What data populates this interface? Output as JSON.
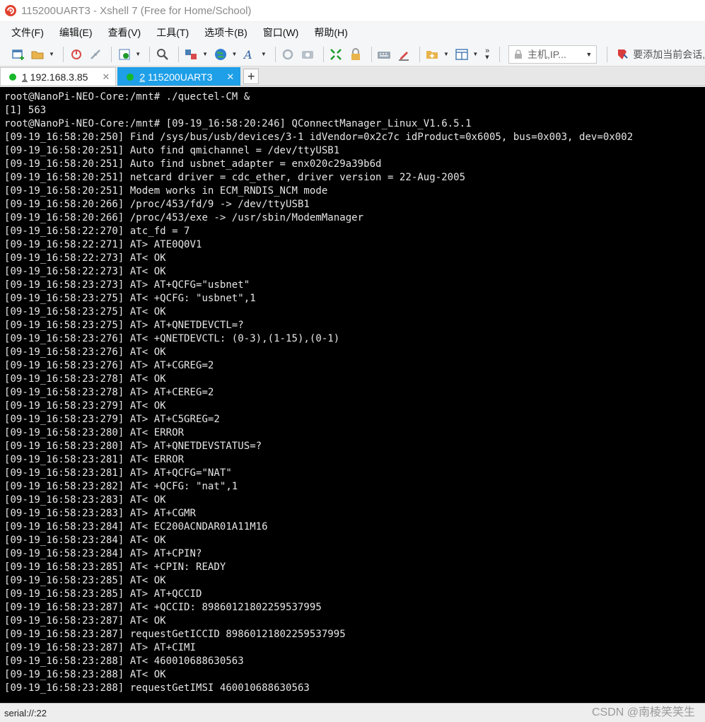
{
  "window": {
    "title": "115200UART3 - Xshell 7 (Free for Home/School)"
  },
  "menu": [
    "文件(F)",
    "编辑(E)",
    "查看(V)",
    "工具(T)",
    "选项卡(B)",
    "窗口(W)",
    "帮助(H)"
  ],
  "toolbar": {
    "host_placeholder": "主机,IP...",
    "add_session_label": "要添加当前会话,",
    "icons": [
      "new-session-icon",
      "open-folder-icon",
      "reconnect-icon",
      "disconnect-icon",
      "properties-icon",
      "find-icon",
      "transfer-icon",
      "globe-icon",
      "font-icon",
      "script-icon",
      "screenshot-icon",
      "fullscreen-icon",
      "lock-icon",
      "keyboard-icon",
      "highlight-icon",
      "new-folder-icon",
      "layout-icon",
      "more-icon"
    ]
  },
  "tabs": [
    {
      "number": "1",
      "label": " 192.168.3.85",
      "active": false
    },
    {
      "number": "2",
      "label": " 115200UART3",
      "active": true
    }
  ],
  "terminal": {
    "lines": [
      "root@NanoPi-NEO-Core:/mnt# ./quectel-CM &",
      "[1] 563",
      "root@NanoPi-NEO-Core:/mnt# [09-19_16:58:20:246] QConnectManager_Linux_V1.6.5.1",
      "[09-19_16:58:20:250] Find /sys/bus/usb/devices/3-1 idVendor=0x2c7c idProduct=0x6005, bus=0x003, dev=0x002",
      "[09-19_16:58:20:251] Auto find qmichannel = /dev/ttyUSB1",
      "[09-19_16:58:20:251] Auto find usbnet_adapter = enx020c29a39b6d",
      "[09-19_16:58:20:251] netcard driver = cdc_ether, driver version = 22-Aug-2005",
      "[09-19_16:58:20:251] Modem works in ECM_RNDIS_NCM mode",
      "[09-19_16:58:20:266] /proc/453/fd/9 -> /dev/ttyUSB1",
      "[09-19_16:58:20:266] /proc/453/exe -> /usr/sbin/ModemManager",
      "[09-19_16:58:22:270] atc_fd = 7",
      "[09-19_16:58:22:271] AT> ATE0Q0V1",
      "[09-19_16:58:22:273] AT< OK",
      "[09-19_16:58:22:273] AT< OK",
      "[09-19_16:58:23:273] AT> AT+QCFG=\"usbnet\"",
      "[09-19_16:58:23:275] AT< +QCFG: \"usbnet\",1",
      "[09-19_16:58:23:275] AT< OK",
      "[09-19_16:58:23:275] AT> AT+QNETDEVCTL=?",
      "[09-19_16:58:23:276] AT< +QNETDEVCTL: (0-3),(1-15),(0-1)",
      "[09-19_16:58:23:276] AT< OK",
      "[09-19_16:58:23:276] AT> AT+CGREG=2",
      "[09-19_16:58:23:278] AT< OK",
      "[09-19_16:58:23:278] AT> AT+CEREG=2",
      "[09-19_16:58:23:279] AT< OK",
      "[09-19_16:58:23:279] AT> AT+C5GREG=2",
      "[09-19_16:58:23:280] AT< ERROR",
      "[09-19_16:58:23:280] AT> AT+QNETDEVSTATUS=?",
      "[09-19_16:58:23:281] AT< ERROR",
      "[09-19_16:58:23:281] AT> AT+QCFG=\"NAT\"",
      "[09-19_16:58:23:282] AT< +QCFG: \"nat\",1",
      "[09-19_16:58:23:283] AT< OK",
      "[09-19_16:58:23:283] AT> AT+CGMR",
      "[09-19_16:58:23:284] AT< EC200ACNDAR01A11M16",
      "[09-19_16:58:23:284] AT< OK",
      "[09-19_16:58:23:284] AT> AT+CPIN?",
      "[09-19_16:58:23:285] AT< +CPIN: READY",
      "[09-19_16:58:23:285] AT< OK",
      "[09-19_16:58:23:285] AT> AT+QCCID",
      "[09-19_16:58:23:287] AT< +QCCID: 89860121802259537995",
      "[09-19_16:58:23:287] AT< OK",
      "[09-19_16:58:23:287] requestGetICCID 89860121802259537995",
      "[09-19_16:58:23:287] AT> AT+CIMI",
      "[09-19_16:58:23:288] AT< 460010688630563",
      "[09-19_16:58:23:288] AT< OK",
      "[09-19_16:58:23:288] requestGetIMSI 460010688630563"
    ]
  },
  "status": {
    "connection": "serial://:22"
  },
  "watermark": "CSDN @南棱笑笑生"
}
